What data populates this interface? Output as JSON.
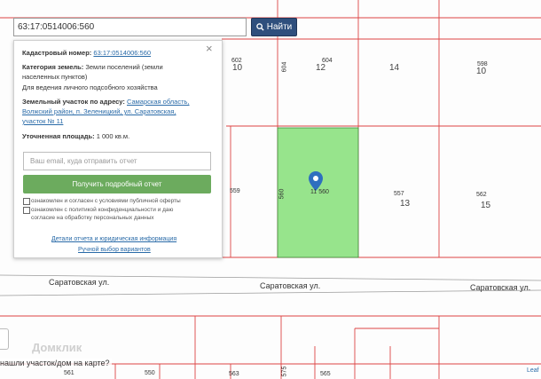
{
  "search": {
    "value": "63:17:0514006:560",
    "button_label": "Найти"
  },
  "popup": {
    "cadastral_label": "Кадастровый номер:",
    "cadastral_value": "63:17:0514006:560",
    "category_label": "Категория земель:",
    "category_value_1": "Земли поселений (земли",
    "category_value_2": "населенных пунктов)",
    "category_value_3": "Для ведения личного подсобного хозяйства",
    "address_label": "Земельный участок по адресу:",
    "address_value_1": "Самарская область,",
    "address_value_2": "Волжский район, п. Зеленицкий, ул. Саратовская,",
    "address_value_3": "участок № 11",
    "area_label": "Уточненная площадь:",
    "area_value": "1 000 кв.м.",
    "email_placeholder": "Ваш email, куда отправить отчет",
    "report_button": "Получить подробный отчет",
    "checkbox1_text": "ознакомлен и согласен с условиями публичной оферты",
    "checkbox2_text_1": "ознакомлен с политикой конфиденциальности и даю",
    "checkbox2_text_2": "согласие на обработку персональных данных",
    "link1": "Детали отчета и юридическая информация",
    "link2": "Ручной выбор вариантов",
    "close_icon": "close-icon"
  },
  "map": {
    "parcel_labels": [
      "602",
      "604",
      "598",
      "559",
      "560",
      "557",
      "562",
      "561",
      "550",
      "563",
      "575",
      "565"
    ],
    "quarter_labels": [
      "10",
      "12",
      "14",
      "10",
      "13",
      "15"
    ],
    "streets": [
      "Саратовская ул.",
      "Саратовская ул.",
      "Саратовская ул."
    ],
    "selected_label": "11 560",
    "selected_color": "#97e48c",
    "marker_icon": "location-pin-icon"
  },
  "bottom_question": "нашли участок/дом на карте?",
  "watermark": "Домклик",
  "attribution": "Leaf"
}
